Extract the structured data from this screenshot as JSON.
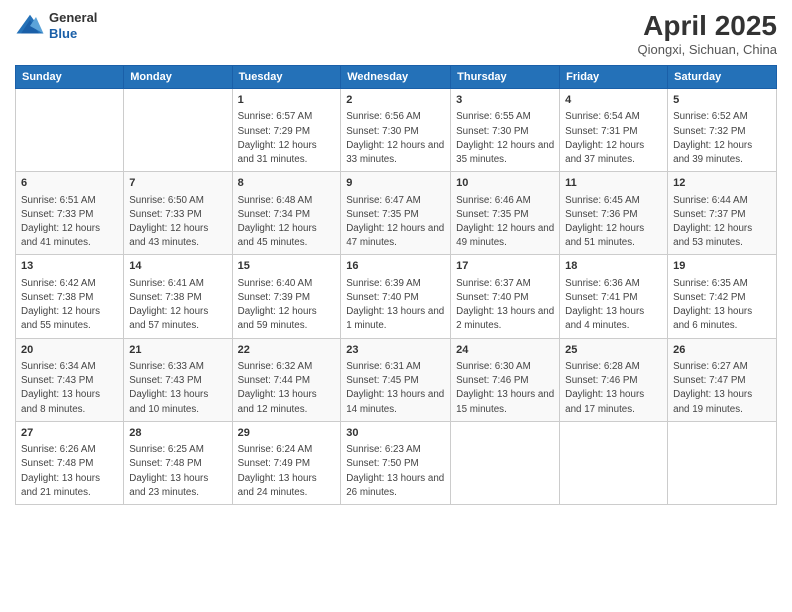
{
  "header": {
    "logo_general": "General",
    "logo_blue": "Blue",
    "title": "April 2025",
    "subtitle": "Qiongxi, Sichuan, China"
  },
  "days_of_week": [
    "Sunday",
    "Monday",
    "Tuesday",
    "Wednesday",
    "Thursday",
    "Friday",
    "Saturday"
  ],
  "weeks": [
    [
      {
        "day": null
      },
      {
        "day": null
      },
      {
        "day": "1",
        "sunrise": "Sunrise: 6:57 AM",
        "sunset": "Sunset: 7:29 PM",
        "daylight": "Daylight: 12 hours and 31 minutes."
      },
      {
        "day": "2",
        "sunrise": "Sunrise: 6:56 AM",
        "sunset": "Sunset: 7:30 PM",
        "daylight": "Daylight: 12 hours and 33 minutes."
      },
      {
        "day": "3",
        "sunrise": "Sunrise: 6:55 AM",
        "sunset": "Sunset: 7:30 PM",
        "daylight": "Daylight: 12 hours and 35 minutes."
      },
      {
        "day": "4",
        "sunrise": "Sunrise: 6:54 AM",
        "sunset": "Sunset: 7:31 PM",
        "daylight": "Daylight: 12 hours and 37 minutes."
      },
      {
        "day": "5",
        "sunrise": "Sunrise: 6:52 AM",
        "sunset": "Sunset: 7:32 PM",
        "daylight": "Daylight: 12 hours and 39 minutes."
      }
    ],
    [
      {
        "day": "6",
        "sunrise": "Sunrise: 6:51 AM",
        "sunset": "Sunset: 7:33 PM",
        "daylight": "Daylight: 12 hours and 41 minutes."
      },
      {
        "day": "7",
        "sunrise": "Sunrise: 6:50 AM",
        "sunset": "Sunset: 7:33 PM",
        "daylight": "Daylight: 12 hours and 43 minutes."
      },
      {
        "day": "8",
        "sunrise": "Sunrise: 6:48 AM",
        "sunset": "Sunset: 7:34 PM",
        "daylight": "Daylight: 12 hours and 45 minutes."
      },
      {
        "day": "9",
        "sunrise": "Sunrise: 6:47 AM",
        "sunset": "Sunset: 7:35 PM",
        "daylight": "Daylight: 12 hours and 47 minutes."
      },
      {
        "day": "10",
        "sunrise": "Sunrise: 6:46 AM",
        "sunset": "Sunset: 7:35 PM",
        "daylight": "Daylight: 12 hours and 49 minutes."
      },
      {
        "day": "11",
        "sunrise": "Sunrise: 6:45 AM",
        "sunset": "Sunset: 7:36 PM",
        "daylight": "Daylight: 12 hours and 51 minutes."
      },
      {
        "day": "12",
        "sunrise": "Sunrise: 6:44 AM",
        "sunset": "Sunset: 7:37 PM",
        "daylight": "Daylight: 12 hours and 53 minutes."
      }
    ],
    [
      {
        "day": "13",
        "sunrise": "Sunrise: 6:42 AM",
        "sunset": "Sunset: 7:38 PM",
        "daylight": "Daylight: 12 hours and 55 minutes."
      },
      {
        "day": "14",
        "sunrise": "Sunrise: 6:41 AM",
        "sunset": "Sunset: 7:38 PM",
        "daylight": "Daylight: 12 hours and 57 minutes."
      },
      {
        "day": "15",
        "sunrise": "Sunrise: 6:40 AM",
        "sunset": "Sunset: 7:39 PM",
        "daylight": "Daylight: 12 hours and 59 minutes."
      },
      {
        "day": "16",
        "sunrise": "Sunrise: 6:39 AM",
        "sunset": "Sunset: 7:40 PM",
        "daylight": "Daylight: 13 hours and 1 minute."
      },
      {
        "day": "17",
        "sunrise": "Sunrise: 6:37 AM",
        "sunset": "Sunset: 7:40 PM",
        "daylight": "Daylight: 13 hours and 2 minutes."
      },
      {
        "day": "18",
        "sunrise": "Sunrise: 6:36 AM",
        "sunset": "Sunset: 7:41 PM",
        "daylight": "Daylight: 13 hours and 4 minutes."
      },
      {
        "day": "19",
        "sunrise": "Sunrise: 6:35 AM",
        "sunset": "Sunset: 7:42 PM",
        "daylight": "Daylight: 13 hours and 6 minutes."
      }
    ],
    [
      {
        "day": "20",
        "sunrise": "Sunrise: 6:34 AM",
        "sunset": "Sunset: 7:43 PM",
        "daylight": "Daylight: 13 hours and 8 minutes."
      },
      {
        "day": "21",
        "sunrise": "Sunrise: 6:33 AM",
        "sunset": "Sunset: 7:43 PM",
        "daylight": "Daylight: 13 hours and 10 minutes."
      },
      {
        "day": "22",
        "sunrise": "Sunrise: 6:32 AM",
        "sunset": "Sunset: 7:44 PM",
        "daylight": "Daylight: 13 hours and 12 minutes."
      },
      {
        "day": "23",
        "sunrise": "Sunrise: 6:31 AM",
        "sunset": "Sunset: 7:45 PM",
        "daylight": "Daylight: 13 hours and 14 minutes."
      },
      {
        "day": "24",
        "sunrise": "Sunrise: 6:30 AM",
        "sunset": "Sunset: 7:46 PM",
        "daylight": "Daylight: 13 hours and 15 minutes."
      },
      {
        "day": "25",
        "sunrise": "Sunrise: 6:28 AM",
        "sunset": "Sunset: 7:46 PM",
        "daylight": "Daylight: 13 hours and 17 minutes."
      },
      {
        "day": "26",
        "sunrise": "Sunrise: 6:27 AM",
        "sunset": "Sunset: 7:47 PM",
        "daylight": "Daylight: 13 hours and 19 minutes."
      }
    ],
    [
      {
        "day": "27",
        "sunrise": "Sunrise: 6:26 AM",
        "sunset": "Sunset: 7:48 PM",
        "daylight": "Daylight: 13 hours and 21 minutes."
      },
      {
        "day": "28",
        "sunrise": "Sunrise: 6:25 AM",
        "sunset": "Sunset: 7:48 PM",
        "daylight": "Daylight: 13 hours and 23 minutes."
      },
      {
        "day": "29",
        "sunrise": "Sunrise: 6:24 AM",
        "sunset": "Sunset: 7:49 PM",
        "daylight": "Daylight: 13 hours and 24 minutes."
      },
      {
        "day": "30",
        "sunrise": "Sunrise: 6:23 AM",
        "sunset": "Sunset: 7:50 PM",
        "daylight": "Daylight: 13 hours and 26 minutes."
      },
      {
        "day": null
      },
      {
        "day": null
      },
      {
        "day": null
      }
    ]
  ]
}
